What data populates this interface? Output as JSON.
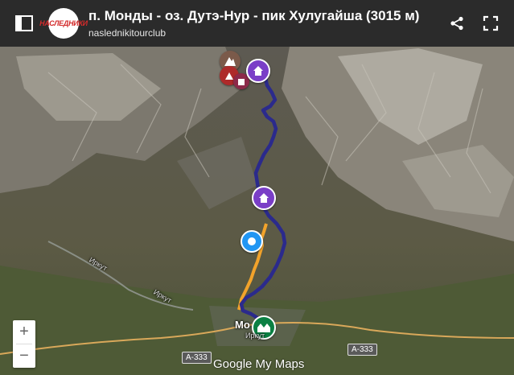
{
  "header": {
    "title": "п. Монды - оз. Дутэ-Нур - пик Хулугайша (3015 м)",
    "subtitle": "naslednikitourclub",
    "logo_text": "НАСЛЕДНИКИ",
    "icons": {
      "sidebar": "sidebar-toggle-icon",
      "share": "share-icon",
      "fullscreen": "fullscreen-icon"
    }
  },
  "map": {
    "place_label": "Мо",
    "road_labels": [
      "A-333",
      "A-333"
    ],
    "river_labels": [
      "Иркут",
      "Иркут",
      "Иркут"
    ],
    "zoom": {
      "in_label": "+",
      "out_label": "−"
    },
    "branding": "Google My Maps",
    "colors": {
      "route_main": "#2b2a8c",
      "route_alt": "#f2a32b",
      "marker_home": "#7a3ec7",
      "marker_peak": "#7b5a4a",
      "marker_lake": "#ae2a2a",
      "marker_start": "#2196f3",
      "marker_village": "#0b8043"
    }
  }
}
